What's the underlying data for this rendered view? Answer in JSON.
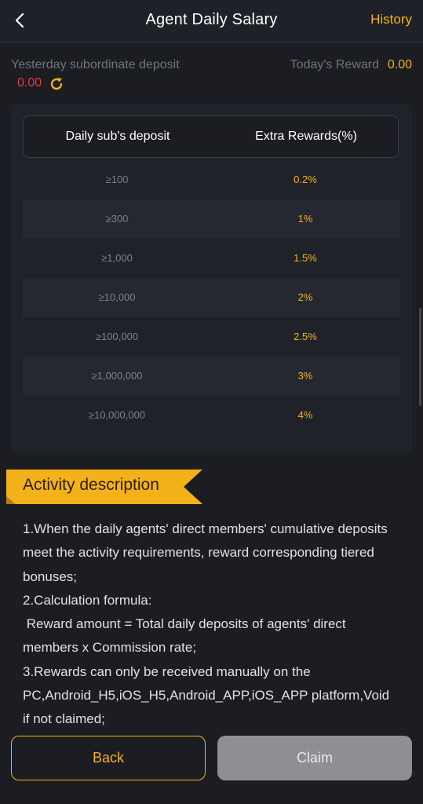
{
  "header": {
    "title": "Agent Daily Salary",
    "history_label": "History"
  },
  "stats": {
    "yesterday_label": "Yesterday subordinate deposit",
    "yesterday_value": "0.00",
    "today_label": "Today's Reward",
    "today_value": "0.00"
  },
  "table": {
    "col_deposit": "Daily sub's deposit",
    "col_reward": "Extra Rewards(%)",
    "rows": [
      {
        "deposit": "≥100",
        "reward": "0.2%"
      },
      {
        "deposit": "≥300",
        "reward": "1%"
      },
      {
        "deposit": "≥1,000",
        "reward": "1.5%"
      },
      {
        "deposit": "≥10,000",
        "reward": "2%"
      },
      {
        "deposit": "≥100,000",
        "reward": "2.5%"
      },
      {
        "deposit": "≥1,000,000",
        "reward": "3%"
      },
      {
        "deposit": "≥10,000,000",
        "reward": "4%"
      }
    ]
  },
  "description": {
    "title": "Activity description",
    "text": "1.When the daily agents' direct members' cumulative deposits meet the activity requirements, reward corresponding tiered bonuses;\n2.Calculation formula:\n Reward amount = Total daily deposits of agents' direct members x Commission rate;\n3.Rewards can only be received manually on the PC,Android_H5,iOS_H5,Android_APP,iOS_APP platform,Void if not claimed;"
  },
  "footer": {
    "back_label": "Back",
    "claim_label": "Claim"
  },
  "colors": {
    "accent": "#f3b21a",
    "negative": "#e4393c",
    "background": "#1b1d22"
  }
}
